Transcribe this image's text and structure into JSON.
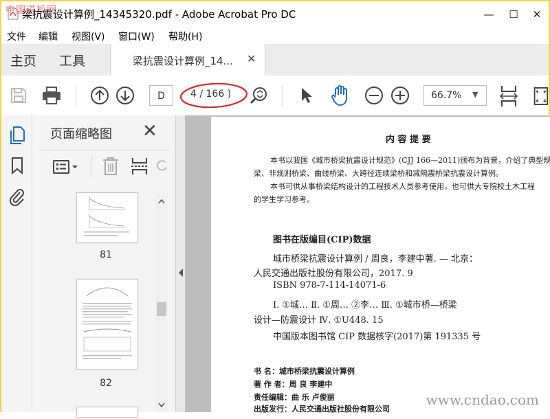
{
  "window": {
    "title": "梁抗震设计算例_14345320.pdf - Adobe Acrobat Pro DC",
    "watermark_top": "中国道板网",
    "controls": [
      "—",
      "☐",
      "✕"
    ]
  },
  "menu": [
    "文件",
    "编辑",
    "视图(V)",
    "窗口(W)",
    "帮助(H)"
  ],
  "tabs": {
    "home": "主页",
    "tools": "工具",
    "doc": "梁抗震设计算例_14...",
    "doc_close": "✕"
  },
  "toolbar": {
    "page_input": "D",
    "page_of": "4 / 166 )",
    "zoom": "66.7%",
    "zoom_caret": "▼",
    "highlight_color": "#d8262a",
    "accent": "#1f6fb8"
  },
  "thumbnails": {
    "title": "页面缩略图",
    "close": "✕",
    "items": [
      {
        "number": "81"
      },
      {
        "number": "82"
      }
    ]
  },
  "document": {
    "heading": "内 容 提 要",
    "intro1_a": "本书以我国《城市桥梁抗震设计规范》(CJJ 166—2011)颁布为背景，介绍了典型规",
    "intro1_b": "梁、非规则桥梁、曲线桥梁、大跨径连续梁桥和减隔震桥梁抗震设计算例。",
    "intro2_a": "本书可供从事桥梁结构设计的工程技术人员参考使用，也可供大专院校土木工程",
    "intro2_b": "的学生学习参考。",
    "cip_title": "图书在版编目(CIP)数据",
    "cip1": "城市桥梁抗震设计算例 / 周良，李建中著. — 北京：",
    "cip2": "人民交通出版社股份有限公司，2017. 9",
    "isbn": "ISBN  978-7-114-14071-6",
    "class1": "Ⅰ. ①城…   Ⅱ. ①周… ②李…   Ⅲ. ①城市桥—桥梁",
    "class2": "设计—防震设计   Ⅳ. ①U448. 15",
    "cip_num": "中国版本图书馆 CIP 数据核字(2017)第 191335 号",
    "book_name": "书      名：城市桥梁抗震设计算例",
    "authors": "著  作  者：周    良    李建中",
    "editor": "责任编辑：曲    乐    卢俊丽",
    "publisher": "出版发行：人民交通出版社股份有限公司"
  },
  "site_watermark": "www.cndao.com"
}
